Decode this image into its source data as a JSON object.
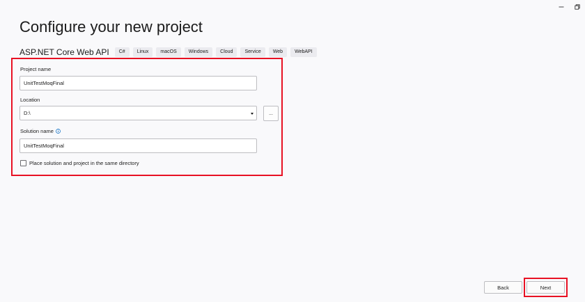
{
  "window": {
    "minimize_icon": "minimize-icon",
    "restore_icon": "restore-icon"
  },
  "page": {
    "title": "Configure your new project"
  },
  "template": {
    "name": "ASP.NET Core Web API",
    "tags": [
      "C#",
      "Linux",
      "macOS",
      "Windows",
      "Cloud",
      "Service",
      "Web",
      "WebAPI"
    ]
  },
  "form": {
    "project_name": {
      "label": "Project name",
      "value": "UnitTestMoqFinal"
    },
    "location": {
      "label": "Location",
      "value": "D:\\",
      "browse_label": "..."
    },
    "solution_name": {
      "label": "Solution name",
      "value": "UnitTestMoqFinal",
      "info_icon": "info-icon"
    },
    "same_directory": {
      "label": "Place solution and project in the same directory",
      "checked": false
    }
  },
  "footer": {
    "back_label": "Back",
    "next_label": "Next"
  },
  "colors": {
    "highlight": "#e81123",
    "info_accent": "#0067c0",
    "background": "#f9f9fb"
  }
}
